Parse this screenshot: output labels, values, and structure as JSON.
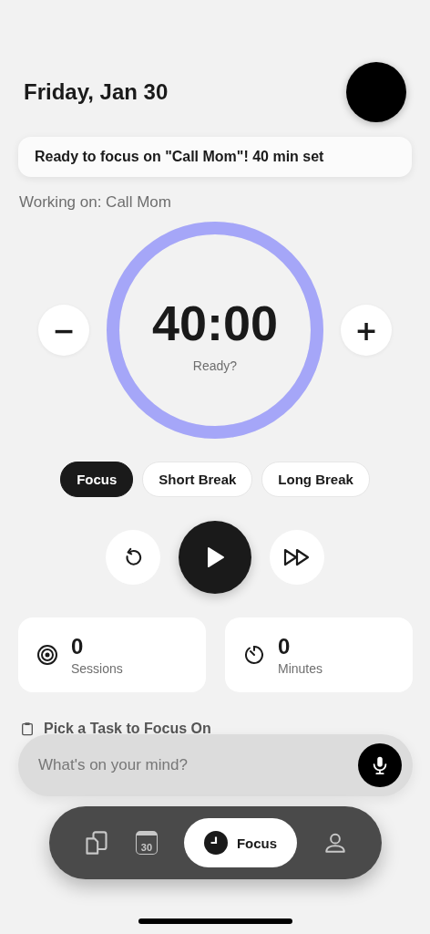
{
  "header": {
    "title": "Friday, Jan 30"
  },
  "banner": {
    "text": "Ready to focus on \"Call Mom\"! 40 min set"
  },
  "working_on": "Working on: Call Mom",
  "timer": {
    "time": "40:00",
    "status": "Ready?",
    "level": 1,
    "decrease": "−",
    "increase": "+"
  },
  "modes": [
    {
      "label": "Focus",
      "selected": true
    },
    {
      "label": "Short Break",
      "selected": false
    },
    {
      "label": "Long Break",
      "selected": false
    }
  ],
  "stats": [
    {
      "kind": "sessions",
      "value": "0",
      "label": "Sessions"
    },
    {
      "kind": "minutes",
      "value": "0",
      "label": "Minutes"
    }
  ],
  "task_section": {
    "title": "Pick a Task to Focus On"
  },
  "input": {
    "placeholder": "What's on your mind?"
  },
  "nav": [
    {
      "kind": "notes",
      "selected": false
    },
    {
      "kind": "calendar",
      "icon_text": "30",
      "selected": false
    },
    {
      "kind": "focus",
      "label": "Focus",
      "selected": true
    },
    {
      "kind": "profile",
      "selected": false
    }
  ]
}
